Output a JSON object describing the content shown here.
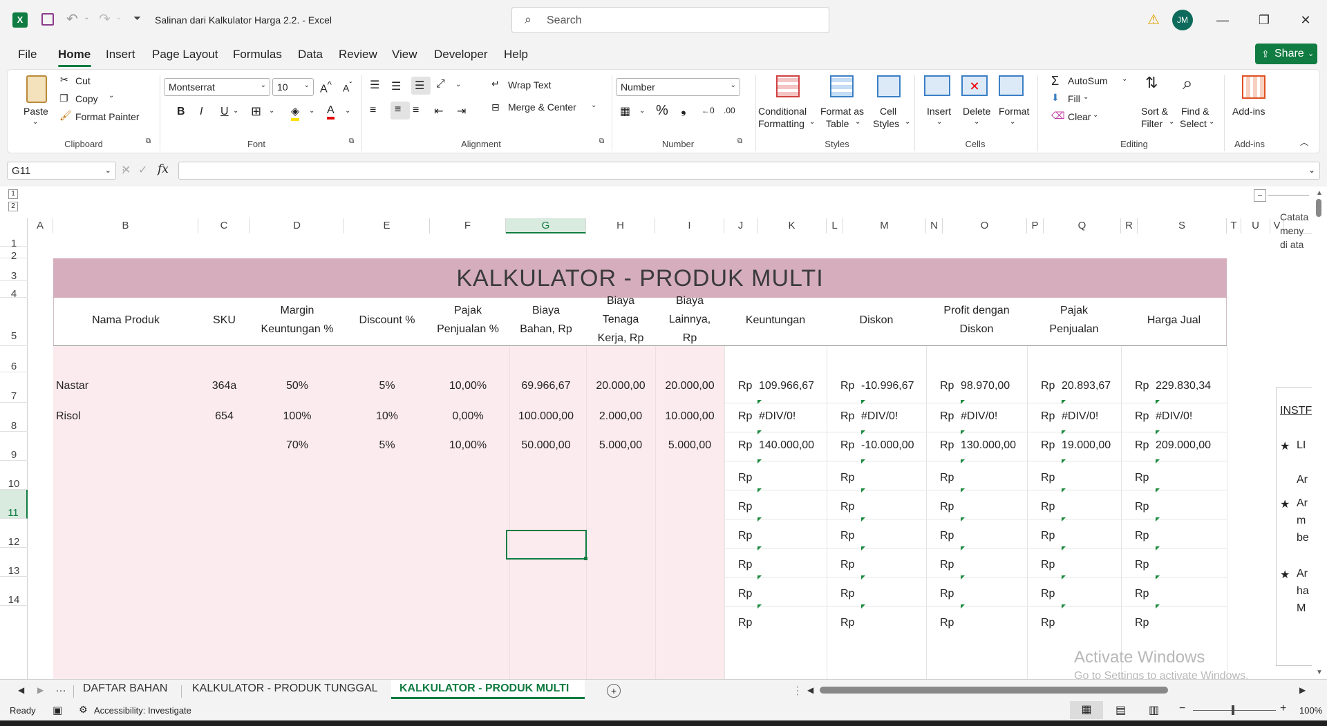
{
  "titlebar": {
    "file_title": "Salinan dari Kalkulator Harga 2.2.  -  Excel",
    "search_placeholder": "Search",
    "avatar_initials": "JM"
  },
  "menu": {
    "items": [
      "File",
      "Home",
      "Insert",
      "Page Layout",
      "Formulas",
      "Data",
      "Review",
      "View",
      "Developer",
      "Help"
    ],
    "share": "Share"
  },
  "ribbon": {
    "clipboard": {
      "paste": "Paste",
      "cut": "Cut",
      "copy": "Copy",
      "format_painter": "Format Painter",
      "label": "Clipboard"
    },
    "font": {
      "font_name": "Montserrat",
      "font_size": "10",
      "label": "Font"
    },
    "alignment": {
      "wrap_text": "Wrap Text",
      "merge_center": "Merge & Center",
      "label": "Alignment"
    },
    "number": {
      "format": "Number",
      "label": "Number"
    },
    "styles": {
      "conditional": "Conditional",
      "formatting": "Formatting",
      "format_as": "Format as",
      "table": "Table",
      "cell": "Cell",
      "styles": "Styles",
      "label": "Styles"
    },
    "cells": {
      "insert": "Insert",
      "delete": "Delete",
      "format": "Format",
      "label": "Cells"
    },
    "editing": {
      "autosum": "AutoSum",
      "fill": "Fill",
      "clear": "Clear",
      "sort": "Sort &",
      "filter": "Filter",
      "find": "Find &",
      "select": "Select",
      "label": "Editing"
    },
    "addins": {
      "addins": "Add-ins",
      "label": "Add-ins"
    }
  },
  "formula_bar": {
    "name_box": "G11",
    "fx": "fx",
    "value": ""
  },
  "grid": {
    "columns": [
      "A",
      "B",
      "C",
      "D",
      "E",
      "F",
      "G",
      "H",
      "I",
      "J",
      "K",
      "L",
      "M",
      "N",
      "O",
      "P",
      "Q",
      "R",
      "S",
      "T",
      "U",
      "V"
    ],
    "rows": [
      "1",
      "2",
      "3",
      "4",
      "5",
      "6",
      "7",
      "8",
      "9",
      "10",
      "11",
      "12",
      "13",
      "14"
    ],
    "outline_levels": [
      "1",
      "2"
    ],
    "title": "KALKULATOR - PRODUK MULTI",
    "headers": {
      "nama_produk": "Nama Produk",
      "sku": "SKU",
      "margin": [
        "Margin",
        "Keuntungan %"
      ],
      "discount": "Discount %",
      "pajak": [
        "Pajak",
        "Penjualan %"
      ],
      "biaya_bahan": [
        "Biaya",
        "Bahan, Rp"
      ],
      "biaya_tenaga": [
        "Biaya",
        "Tenaga",
        "Kerja, Rp"
      ],
      "biaya_lain": [
        "Biaya",
        "Lainnya,",
        "Rp"
      ],
      "keuntungan": "Keuntungan",
      "diskon": "Diskon",
      "profit": [
        "Profit dengan",
        "Diskon"
      ],
      "pajak_penjualan": [
        "Pajak",
        "Penjualan"
      ],
      "harga_jual": "Harga Jual"
    },
    "currency": "Rp",
    "data_rows": [
      {
        "row": "6",
        "nama": "Nastar",
        "sku": "364a",
        "margin": "50%",
        "discount": "5%",
        "pajak": "10,00%",
        "bahan": "69.966,67",
        "tenaga": "20.000,00",
        "lain": "20.000,00",
        "keuntungan": "109.966,67",
        "diskon": "-10.996,67",
        "profit": "98.970,00",
        "pajak_penjualan": "20.893,67",
        "harga_jual": "229.830,34"
      },
      {
        "row": "7",
        "nama": "Risol",
        "sku": "654",
        "margin": "100%",
        "discount": "10%",
        "pajak": "0,00%",
        "bahan": "100.000,00",
        "tenaga": "2.000,00",
        "lain": "10.000,00",
        "keuntungan": "#DIV/0!",
        "diskon": "#DIV/0!",
        "profit": "#DIV/0!",
        "pajak_penjualan": "#DIV/0!",
        "harga_jual": "#DIV/0!"
      },
      {
        "row": "8",
        "nama": "",
        "sku": "",
        "margin": "70%",
        "discount": "5%",
        "pajak": "10,00%",
        "bahan": "50.000,00",
        "tenaga": "5.000,00",
        "lain": "5.000,00",
        "keuntungan": "140.000,00",
        "diskon": "-10.000,00",
        "profit": "130.000,00",
        "pajak_penjualan": "19.000,00",
        "harga_jual": "209.000,00"
      }
    ],
    "side_notes": {
      "catatan": [
        "Catata",
        "meny",
        "di ata"
      ],
      "instr": "INSTF",
      "bullets": [
        [
          "LI",
          "Ar"
        ],
        [
          "Ar",
          "m",
          "be"
        ],
        [
          "Ar",
          "ha",
          "M"
        ]
      ]
    }
  },
  "tabs": [
    "DAFTAR BAHAN",
    "KALKULATOR - PRODUK TUNGGAL",
    "KALKULATOR - PRODUK MULTI"
  ],
  "watermark": {
    "line1": "Activate Windows",
    "line2": "Go to Settings to activate Windows."
  },
  "status": {
    "ready": "Ready",
    "accessibility": "Accessibility: Investigate",
    "zoom": "100%"
  },
  "colors": {
    "accent": "#107c41",
    "title_band": "#d5adbc",
    "input_fill": "#fbeaee"
  }
}
